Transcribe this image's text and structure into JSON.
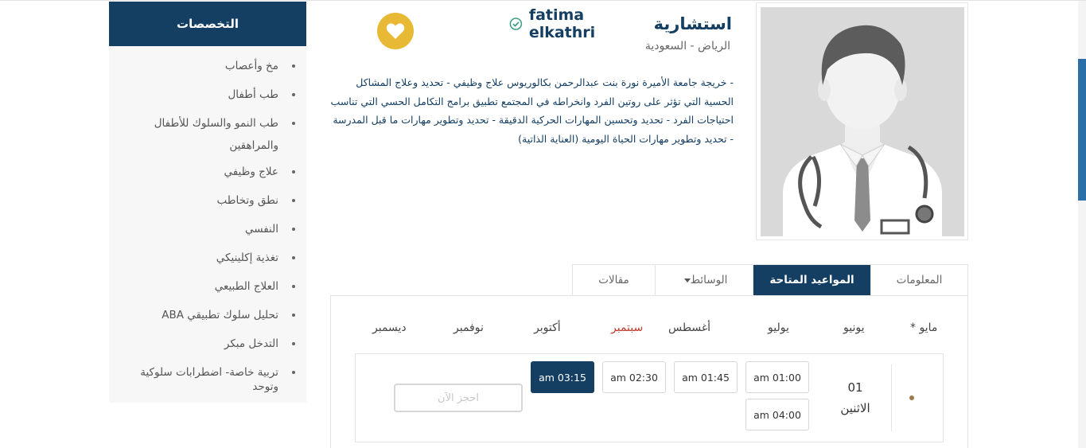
{
  "sidebar": {
    "title": "التخصصات",
    "items": [
      "مخ وأعصاب",
      "طب أطفال",
      "طب النمو والسلوك للأطفال والمراهقين",
      "علاج وظيفي",
      "نطق وتخاطب",
      "النفسي",
      "تغذية إكلينيكي",
      "العلاج الطبيعي",
      "تحليل سلوك تطبيقي ABA",
      "التدخل مبكر",
      "تربية خاصة- اضطرابات سلوكية وتوحد"
    ]
  },
  "profile": {
    "title": "استشارية",
    "name": "fatima elkathri",
    "location": "الرياض - السعودية",
    "bio": "- خريجة جامعة الأميرة نورة بنت عبدالرحمن بكالوريوس علاج وظيفي - تحديد وعلاج المشاكل الحسية التي تؤثر على روتين الفرد وانخراطه في المجتمع تطبيق برامج التكامل الحسي التي تناسب احتياجات الفرد - تحديد وتحسين المهارات الحركية الدقيقة - تحديد وتطوير مهارات ما قبل المدرسة - تحديد وتطوير مهارات الحياة اليومية (العناية الذاتية)",
    "verified_icon": "check-circle-icon",
    "favorite_icon": "heart-icon"
  },
  "tabs": [
    {
      "label": "المعلومات",
      "active": false
    },
    {
      "label": "المواعيد المتاحة",
      "active": true
    },
    {
      "label": "الوسائط",
      "active": false,
      "dropdown": true
    },
    {
      "label": "مقالات",
      "active": false
    }
  ],
  "schedule": {
    "months": [
      "مايو *",
      "يونيو",
      "يوليو",
      "أغسطس",
      "سبتمبر",
      "أكتوبر",
      "نوفمبر",
      "ديسمبر"
    ],
    "current_month": "سبتمبر",
    "day_number": "01",
    "day_name": "الاثنين",
    "slots": [
      "am 01:00",
      "am 01:45",
      "am 02:30",
      "am 03:15",
      "am 04:00"
    ],
    "selected_slot": "am 03:15",
    "book_placeholder": "احجز الآن"
  },
  "colors": {
    "primary": "#143e62",
    "accent": "#e7b935",
    "current_month": "#c0392b",
    "verified": "#3aa17e"
  }
}
